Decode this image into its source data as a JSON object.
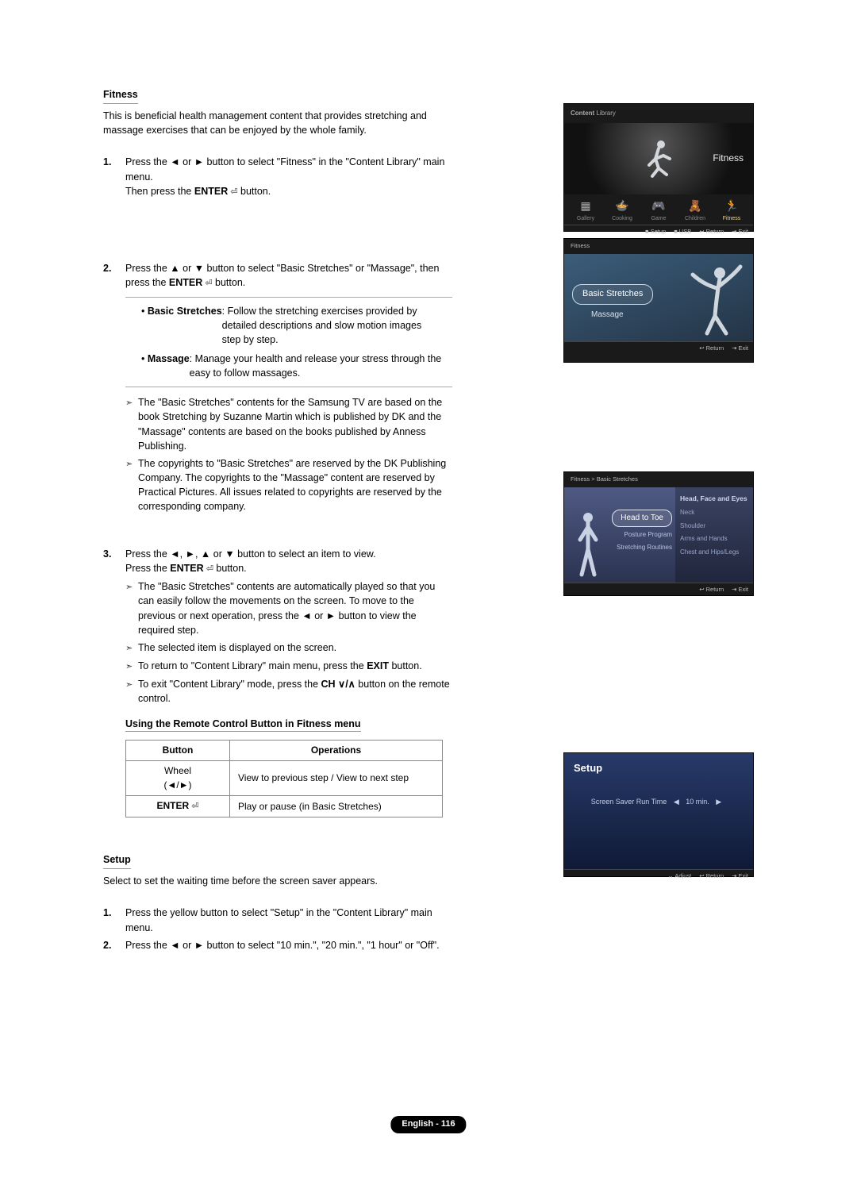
{
  "section_fitness": {
    "title": "Fitness",
    "intro": "This is beneficial health management content that provides stretching and massage exercises that can be enjoyed by the whole family.",
    "step1_a": "Press the ◄ or ► button to select \"Fitness\" in the \"Content Library\" main menu.",
    "step1_b_pre": "Then press the ",
    "enter_word": "ENTER",
    "step1_b_post": " button.",
    "step2_a": "Press the ▲ or ▼ button to select \"Basic Stretches\" or \"Massage\", then press the ",
    "step2_a_post": " button.",
    "inset_bs_label": "Basic Stretches",
    "inset_bs_text": ": Follow the stretching exercises provided by detailed descriptions and slow motion images step by step.",
    "inset_mg_label": "Massage",
    "inset_mg_text": ": Manage your health and release your stress through the easy to follow massages.",
    "step2_note1": "The \"Basic Stretches\" contents for the Samsung TV are based on the book Stretching by Suzanne Martin which is published by DK and the \"Massage\" contents are based on the books published by Anness Publishing.",
    "step2_note2": "The copyrights to \"Basic Stretches\" are reserved by the DK Publishing Company. The copyrights to the \"Massage\" content are reserved by Practical Pictures. All issues related to copyrights are reserved by the corresponding company.",
    "step3_a": "Press the ◄, ►, ▲ or ▼ button to select an item to view.",
    "step3_b_pre": "Press the ",
    "step3_b_post": " button.",
    "step3_note1": "The \"Basic Stretches\" contents are automatically played so that you can easily follow the movements on the screen. To move to the previous or next operation, press the ◄ or ► button to view the required step.",
    "step3_note2": "The selected item is displayed on the screen.",
    "step3_note3_pre": "To return to \"Content Library\" main menu, press the ",
    "exit_word": "EXIT",
    "step3_note3_post": " button.",
    "step3_note4_pre": "To exit \"Content Library\" mode, press the ",
    "ch_word": "CH ∨/∧",
    "step3_note4_post": " button on the remote control."
  },
  "remote_table": {
    "heading": "Using the Remote Control Button in Fitness menu",
    "col_button": "Button",
    "col_ops": "Operations",
    "row1_btn": "Wheel\n(◄/►)",
    "row1_ops": "View to previous step / View to next step",
    "row2_btn": "ENTER",
    "row2_ops": "Play or pause (in Basic Stretches)"
  },
  "section_setup": {
    "title": "Setup",
    "intro": "Select to set the waiting time before the screen saver appears.",
    "step1": "Press the yellow button to select \"Setup\" in the \"Content Library\" main menu.",
    "step2": "Press the ◄ or ► button to select \"10 min.\", \"20 min.\", \"1 hour\" or \"Off\"."
  },
  "footer": "English - 116",
  "tv1": {
    "header_pre": "Content",
    "header_post": " Library",
    "fitness": "Fitness",
    "items": [
      "Gallery",
      "Cooking",
      "Game",
      "Children",
      "Fitness"
    ],
    "foot": [
      "■ Setup",
      "■ USB",
      "↩ Return",
      "⇥ Exit"
    ]
  },
  "tv2": {
    "crumb": "Fitness",
    "pill": "Basic Stretches",
    "massage": "Massage",
    "foot": [
      "↩ Return",
      "⇥ Exit"
    ]
  },
  "tv3": {
    "crumb": "Fitness > Basic Stretches",
    "pill": "Head to Toe",
    "sub_a": "Posture Program",
    "sub_b": "Stretching Routines",
    "right_title": "Head, Face and Eyes",
    "right_items": [
      "Neck",
      "Shoulder",
      "Arms and Hands",
      "Chest and Hips/Legs"
    ],
    "foot": [
      "↩ Return",
      "⇥ Exit"
    ]
  },
  "tv4": {
    "title": "Setup",
    "row_label": "Screen Saver Run Time",
    "row_value": "10 min.",
    "foot": [
      "↔ Adjust",
      "↩ Return",
      "⇥ Exit"
    ]
  }
}
